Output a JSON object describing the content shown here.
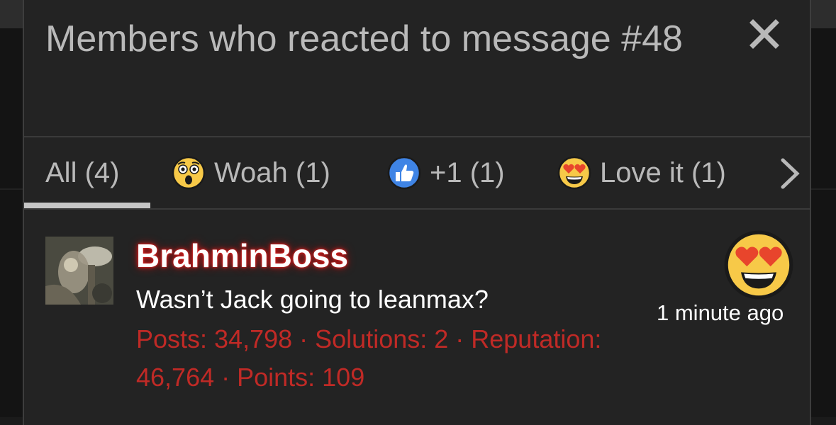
{
  "modal": {
    "title": "Members who reacted to message #48",
    "close_icon": "close-icon"
  },
  "tabs": [
    {
      "label": "All (4)",
      "icon": "",
      "active": true
    },
    {
      "label": "Woah (1)",
      "icon": "astonished-face-icon",
      "active": false
    },
    {
      "label": "+1 (1)",
      "icon": "thumbs-up-icon",
      "active": false
    },
    {
      "label": "Love it (1)",
      "icon": "heart-eyes-face-icon",
      "active": false
    }
  ],
  "tabs_next_icon": "chevron-right-icon",
  "member": {
    "username": "BrahminBoss",
    "message": "Wasn’t Jack going to leanmax?",
    "stats": "Posts: 34,798 · Solutions: 2 · Reputation: 46,764 · Points: 109",
    "reaction_icon": "heart-eyes-face-icon",
    "time": "1 minute ago"
  },
  "colors": {
    "modal_bg": "#232323",
    "title_text": "#b9b9b9",
    "username_glow": "#e02020",
    "stats_text": "#c02a26",
    "tab_underline": "#c6c6c6"
  }
}
